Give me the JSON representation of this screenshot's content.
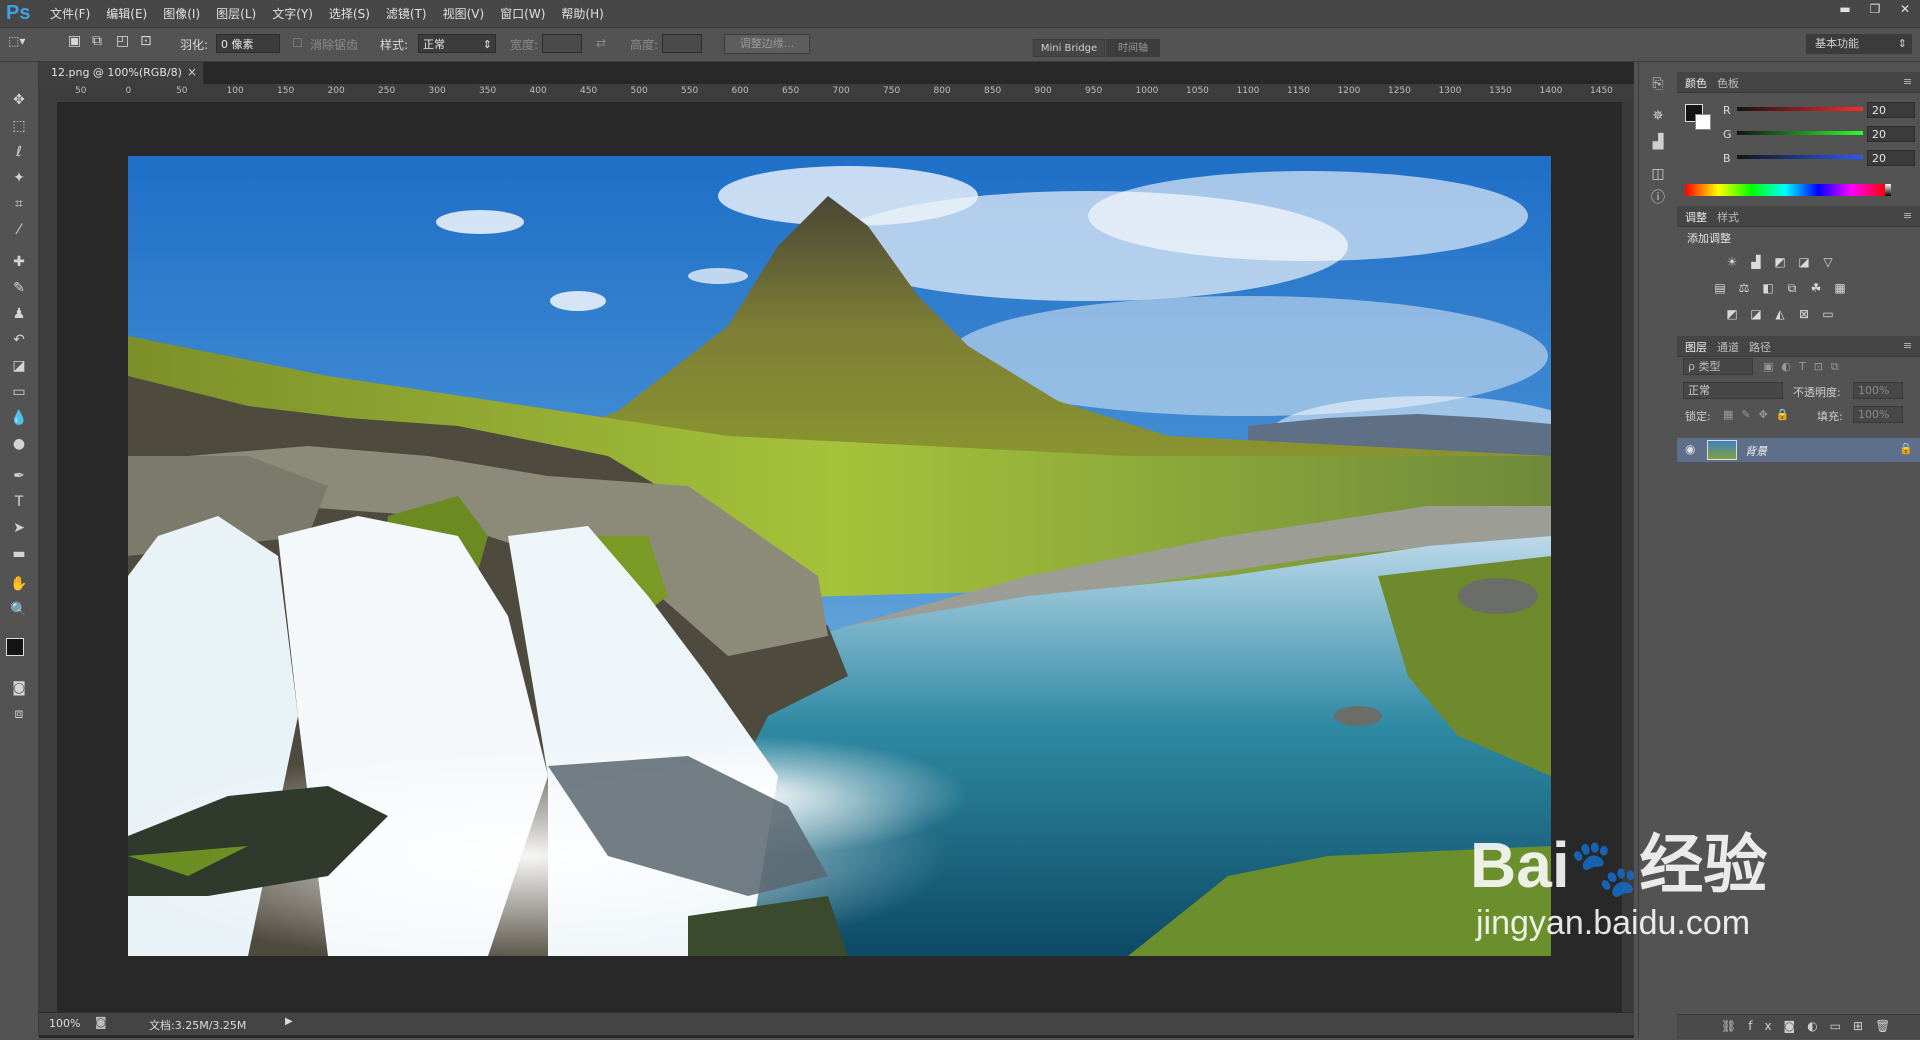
{
  "app": {
    "logo": "Ps"
  },
  "menu": [
    "文件(F)",
    "编辑(E)",
    "图像(I)",
    "图层(L)",
    "文字(Y)",
    "选择(S)",
    "滤镜(T)",
    "视图(V)",
    "窗口(W)",
    "帮助(H)"
  ],
  "window_controls": {
    "minimize": "▬",
    "restore": "❐",
    "close": "✕"
  },
  "options": {
    "feather_label": "羽化:",
    "feather_value": "0 像素",
    "antialias_label": "消除锯齿",
    "style_label": "样式:",
    "style_value": "正常",
    "width_label": "宽度:",
    "height_label": "高度:",
    "refine_edge": "调整边缘...",
    "mini_bridge": "Mini Bridge",
    "timeline": "时间轴",
    "workspace": "基本功能"
  },
  "document": {
    "tab_title": "12.png @ 100%(RGB/8)",
    "tab_close": "×",
    "zoom": "100%",
    "doc_info": "文档:3.25M/3.25M",
    "ruler_marks": [
      "50",
      "0",
      "50",
      "100",
      "150",
      "200",
      "250",
      "300",
      "350",
      "400",
      "450",
      "500",
      "550",
      "600",
      "650",
      "700",
      "750",
      "800",
      "850",
      "900",
      "950",
      "1000",
      "1050",
      "1100",
      "1150",
      "1200",
      "1250",
      "1300",
      "1350",
      "1400",
      "1450"
    ]
  },
  "color_panel": {
    "tabs": [
      "颜色",
      "色板"
    ],
    "channels": [
      {
        "label": "R",
        "value": "20",
        "gradient": "#ff2a2a"
      },
      {
        "label": "G",
        "value": "20",
        "gradient": "#2aff2a"
      },
      {
        "label": "B",
        "value": "20",
        "gradient": "#2a5aff"
      }
    ]
  },
  "adjust_panel": {
    "tabs": [
      "调整",
      "样式"
    ],
    "title": "添加调整"
  },
  "layers_panel": {
    "tabs": [
      "图层",
      "通道",
      "路径"
    ],
    "kind": "ρ 类型",
    "blend_mode": "正常",
    "opacity_label": "不透明度:",
    "opacity_value": "100%",
    "lock_label": "锁定:",
    "fill_label": "填充:",
    "fill_value": "100%",
    "layer_name": "背景"
  },
  "watermark": {
    "brand": "Bai",
    "brand2": "经验",
    "url": "jingyan.baidu.com"
  }
}
